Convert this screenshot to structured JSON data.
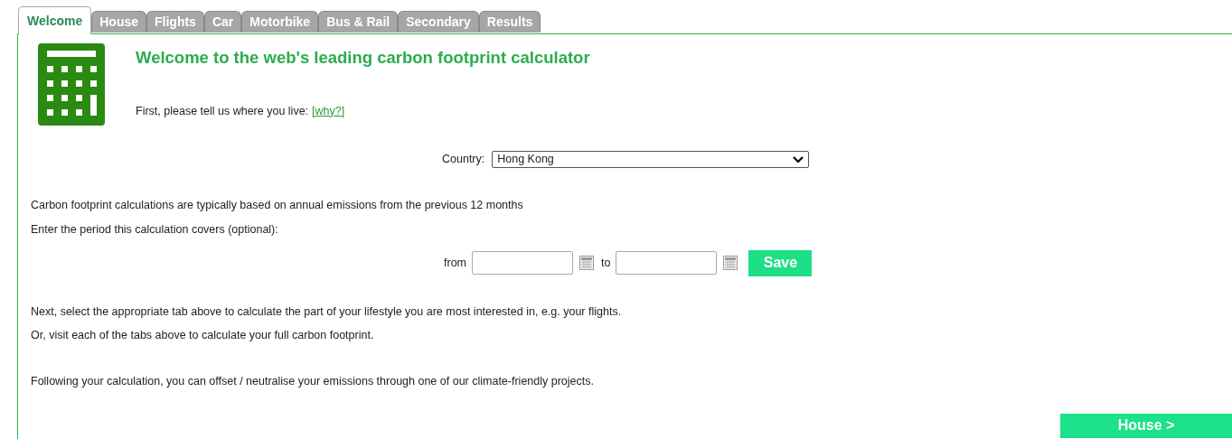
{
  "tabs": [
    {
      "label": "Welcome",
      "selected": true
    },
    {
      "label": "House",
      "selected": false
    },
    {
      "label": "Flights",
      "selected": false
    },
    {
      "label": "Car",
      "selected": false
    },
    {
      "label": "Motorbike",
      "selected": false
    },
    {
      "label": "Bus & Rail",
      "selected": false
    },
    {
      "label": "Secondary",
      "selected": false
    },
    {
      "label": "Results",
      "selected": false
    }
  ],
  "heading": "Welcome to the web's leading carbon footprint calculator",
  "location_prompt": {
    "text": "First, please tell us where you live:",
    "link": "[why?]"
  },
  "country": {
    "label": "Country:",
    "value": "Hong Kong"
  },
  "period_intro": [
    "Carbon footprint calculations are typically based on annual emissions from the previous 12 months",
    "Enter the period this calculation covers (optional):"
  ],
  "period": {
    "from_label": "from",
    "to_label": "to",
    "save": "Save"
  },
  "next_steps": [
    "Next, select the appropriate tab above to calculate the part of your lifestyle you are most interested in, e.g. your flights.",
    "Or, visit each of the tabs above to calculate your full carbon footprint."
  ],
  "offset_note": "Following your calculation, you can offset / neutralise your emissions through one of our climate-friendly projects.",
  "next_button": "House >"
}
